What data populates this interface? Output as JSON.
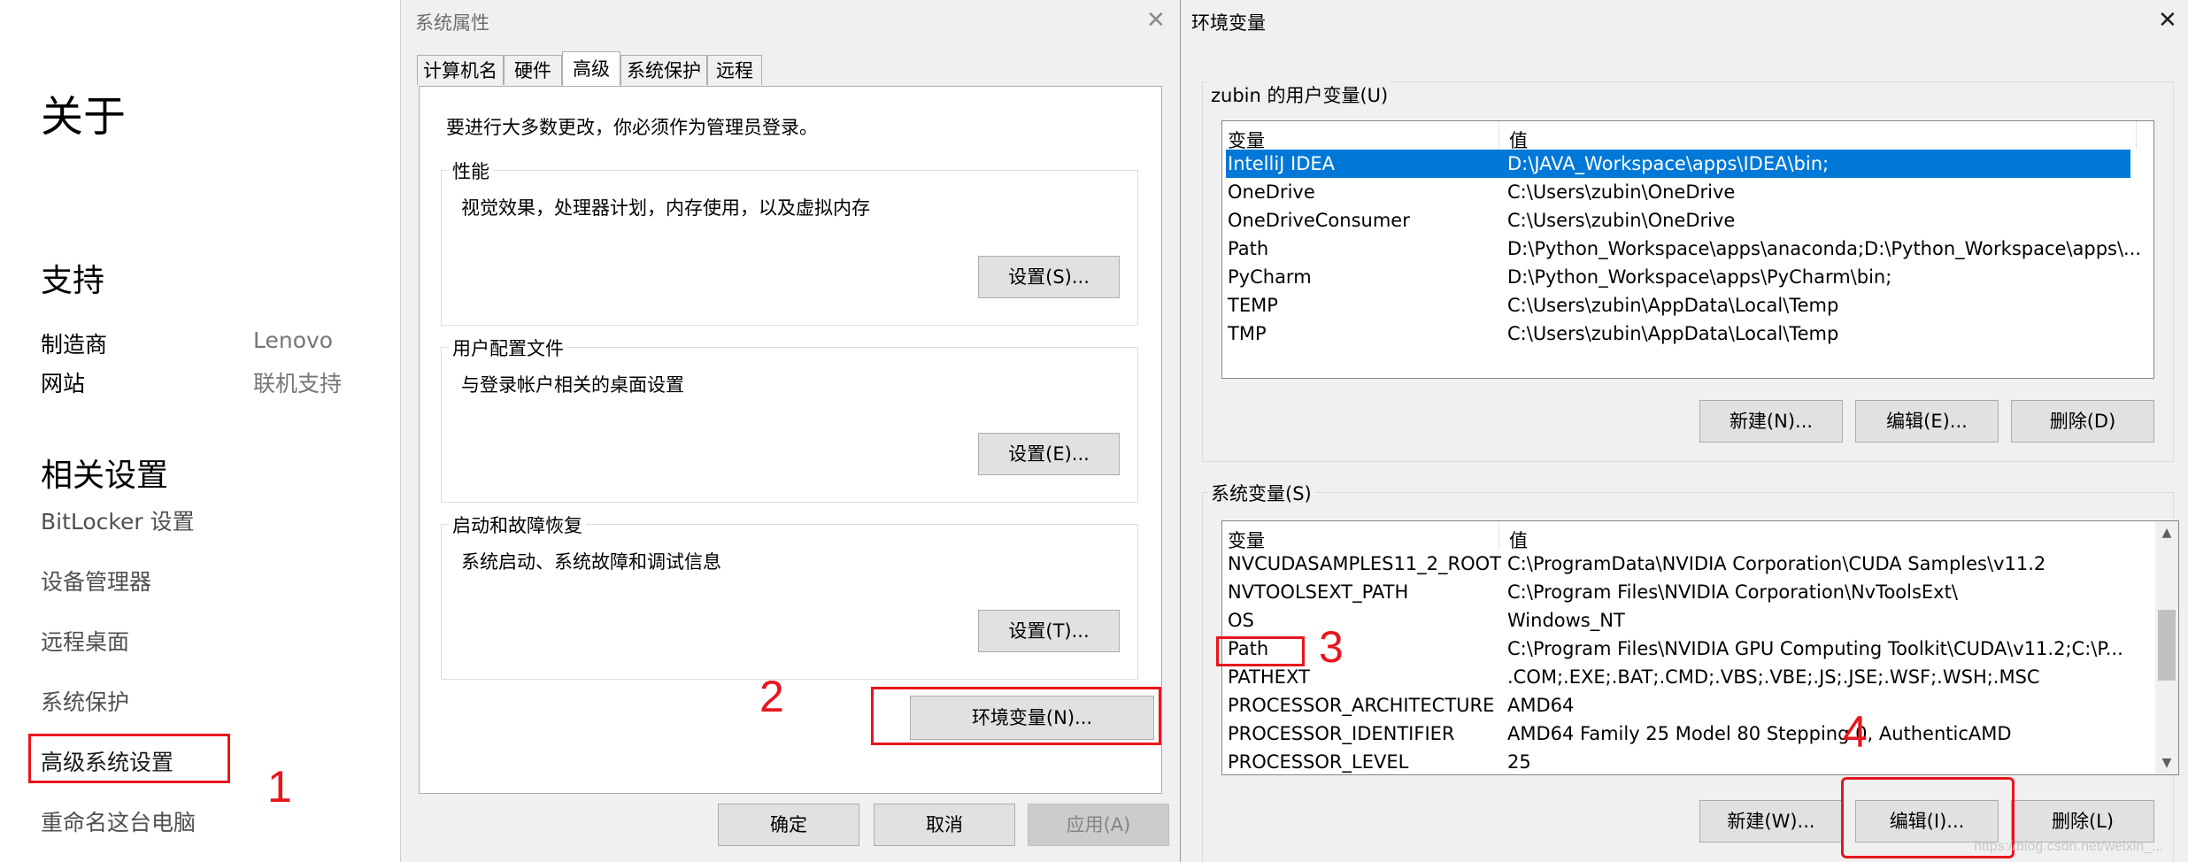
{
  "settings": {
    "about_title": "关于",
    "support_title": "支持",
    "support_rows": [
      {
        "key": "制造商",
        "value": "Lenovo"
      },
      {
        "key": "网站",
        "value": "联机支持"
      }
    ],
    "related_title": "相关设置",
    "links": [
      "BitLocker 设置",
      "设备管理器",
      "远程桌面",
      "系统保护",
      "高级系统设置",
      "重命名这台电脑"
    ]
  },
  "system_properties": {
    "title": "系统属性",
    "tabs": [
      "计算机名",
      "硬件",
      "高级",
      "系统保护",
      "远程"
    ],
    "active_tab": "高级",
    "admin_note": "要进行大多数更改，你必须作为管理员登录。",
    "groups": [
      {
        "title": "性能",
        "desc": "视觉效果，处理器计划，内存使用，以及虚拟内存",
        "button": "设置(S)..."
      },
      {
        "title": "用户配置文件",
        "desc": "与登录帐户相关的桌面设置",
        "button": "设置(E)..."
      },
      {
        "title": "启动和故障恢复",
        "desc": "系统启动、系统故障和调试信息",
        "button": "设置(T)..."
      }
    ],
    "env_button": "环境变量(N)...",
    "ok": "确定",
    "cancel": "取消",
    "apply": "应用(A)"
  },
  "env_vars": {
    "title": "环境变量",
    "user_group_title": "zubin 的用户变量(U)",
    "col_var": "变量",
    "col_val": "值",
    "user_vars": [
      {
        "name": "IntelliJ IDEA",
        "value": "D:\\JAVA_Workspace\\apps\\IDEA\\bin;",
        "selected": true
      },
      {
        "name": "OneDrive",
        "value": "C:\\Users\\zubin\\OneDrive"
      },
      {
        "name": "OneDriveConsumer",
        "value": "C:\\Users\\zubin\\OneDrive"
      },
      {
        "name": "Path",
        "value": "D:\\Python_Workspace\\apps\\anaconda;D:\\Python_Workspace\\apps\\..."
      },
      {
        "name": "PyCharm",
        "value": "D:\\Python_Workspace\\apps\\PyCharm\\bin;"
      },
      {
        "name": "TEMP",
        "value": "C:\\Users\\zubin\\AppData\\Local\\Temp"
      },
      {
        "name": "TMP",
        "value": "C:\\Users\\zubin\\AppData\\Local\\Temp"
      }
    ],
    "user_buttons": {
      "new": "新建(N)...",
      "edit": "编辑(E)...",
      "delete": "删除(D)"
    },
    "system_group_title": "系统变量(S)",
    "system_vars": [
      {
        "name": "NVCUDASAMPLES11_2_ROOT",
        "value": "C:\\ProgramData\\NVIDIA Corporation\\CUDA Samples\\v11.2"
      },
      {
        "name": "NVTOOLSEXT_PATH",
        "value": "C:\\Program Files\\NVIDIA Corporation\\NvToolsExt\\"
      },
      {
        "name": "OS",
        "value": "Windows_NT"
      },
      {
        "name": "Path",
        "value": "C:\\Program Files\\NVIDIA GPU Computing Toolkit\\CUDA\\v11.2;C:\\P..."
      },
      {
        "name": "PATHEXT",
        "value": ".COM;.EXE;.BAT;.CMD;.VBS;.VBE;.JS;.JSE;.WSF;.WSH;.MSC"
      },
      {
        "name": "PROCESSOR_ARCHITECTURE",
        "value": "AMD64"
      },
      {
        "name": "PROCESSOR_IDENTIFIER",
        "value": "AMD64 Family 25 Model 80 Stepping 0, AuthenticAMD"
      },
      {
        "name": "PROCESSOR_LEVEL",
        "value": "25"
      }
    ],
    "system_buttons": {
      "new": "新建(W)...",
      "edit": "编辑(I)...",
      "delete": "删除(L)"
    }
  },
  "annotations": {
    "step1": "1",
    "step2": "2",
    "step3": "3",
    "step4": "4",
    "accent_color": "#e8151d"
  },
  "watermark": "https://blog.csdn.net/weixin_..."
}
